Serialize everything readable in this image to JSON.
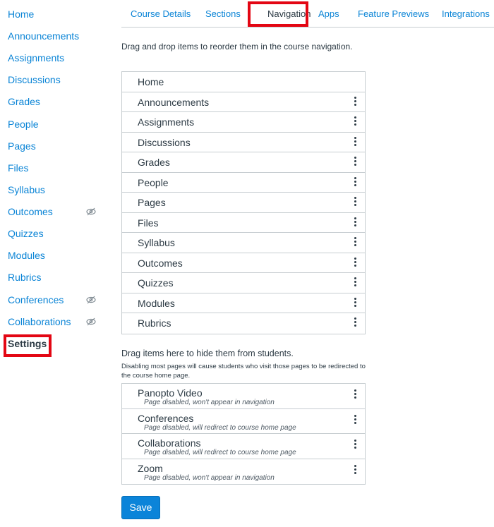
{
  "sidebar": {
    "items": [
      {
        "label": "Home",
        "hidden": false
      },
      {
        "label": "Announcements",
        "hidden": false
      },
      {
        "label": "Assignments",
        "hidden": false
      },
      {
        "label": "Discussions",
        "hidden": false
      },
      {
        "label": "Grades",
        "hidden": false
      },
      {
        "label": "People",
        "hidden": false
      },
      {
        "label": "Pages",
        "hidden": false
      },
      {
        "label": "Files",
        "hidden": false
      },
      {
        "label": "Syllabus",
        "hidden": false
      },
      {
        "label": "Outcomes",
        "hidden": true
      },
      {
        "label": "Quizzes",
        "hidden": false
      },
      {
        "label": "Modules",
        "hidden": false
      },
      {
        "label": "Rubrics",
        "hidden": false
      },
      {
        "label": "Conferences",
        "hidden": true
      },
      {
        "label": "Collaborations",
        "hidden": true
      },
      {
        "label": "Settings",
        "hidden": false,
        "active": true
      }
    ],
    "hidden_icon": "eye-slash-icon"
  },
  "tabs": [
    {
      "label": "Course Details"
    },
    {
      "label": "Sections"
    },
    {
      "label": "Navigation",
      "active": true
    },
    {
      "label": "Apps"
    },
    {
      "label": "Feature Previews"
    },
    {
      "label": "Integrations"
    }
  ],
  "main": {
    "intro": "Drag and drop items to reorder them in the course navigation.",
    "enabled_items": [
      "Home",
      "Announcements",
      "Assignments",
      "Discussions",
      "Grades",
      "People",
      "Pages",
      "Files",
      "Syllabus",
      "Outcomes",
      "Quizzes",
      "Modules",
      "Rubrics"
    ],
    "hidden_heading": "Drag items here to hide them from students.",
    "hidden_note": "Disabling most pages will cause students who visit those pages to be redirected to the course home page.",
    "disabled_items": [
      {
        "label": "Panopto Video",
        "status": "Page disabled, won't appear in navigation"
      },
      {
        "label": "Conferences",
        "status": "Page disabled, will redirect to course home page"
      },
      {
        "label": "Collaborations",
        "status": "Page disabled, will redirect to course home page"
      },
      {
        "label": "Zoom",
        "status": "Page disabled, won't appear in navigation"
      }
    ],
    "save_label": "Save"
  },
  "colors": {
    "link": "#0a84d6",
    "text": "#2d3b45",
    "button": "#0b84d9",
    "highlight": "#e30613"
  }
}
